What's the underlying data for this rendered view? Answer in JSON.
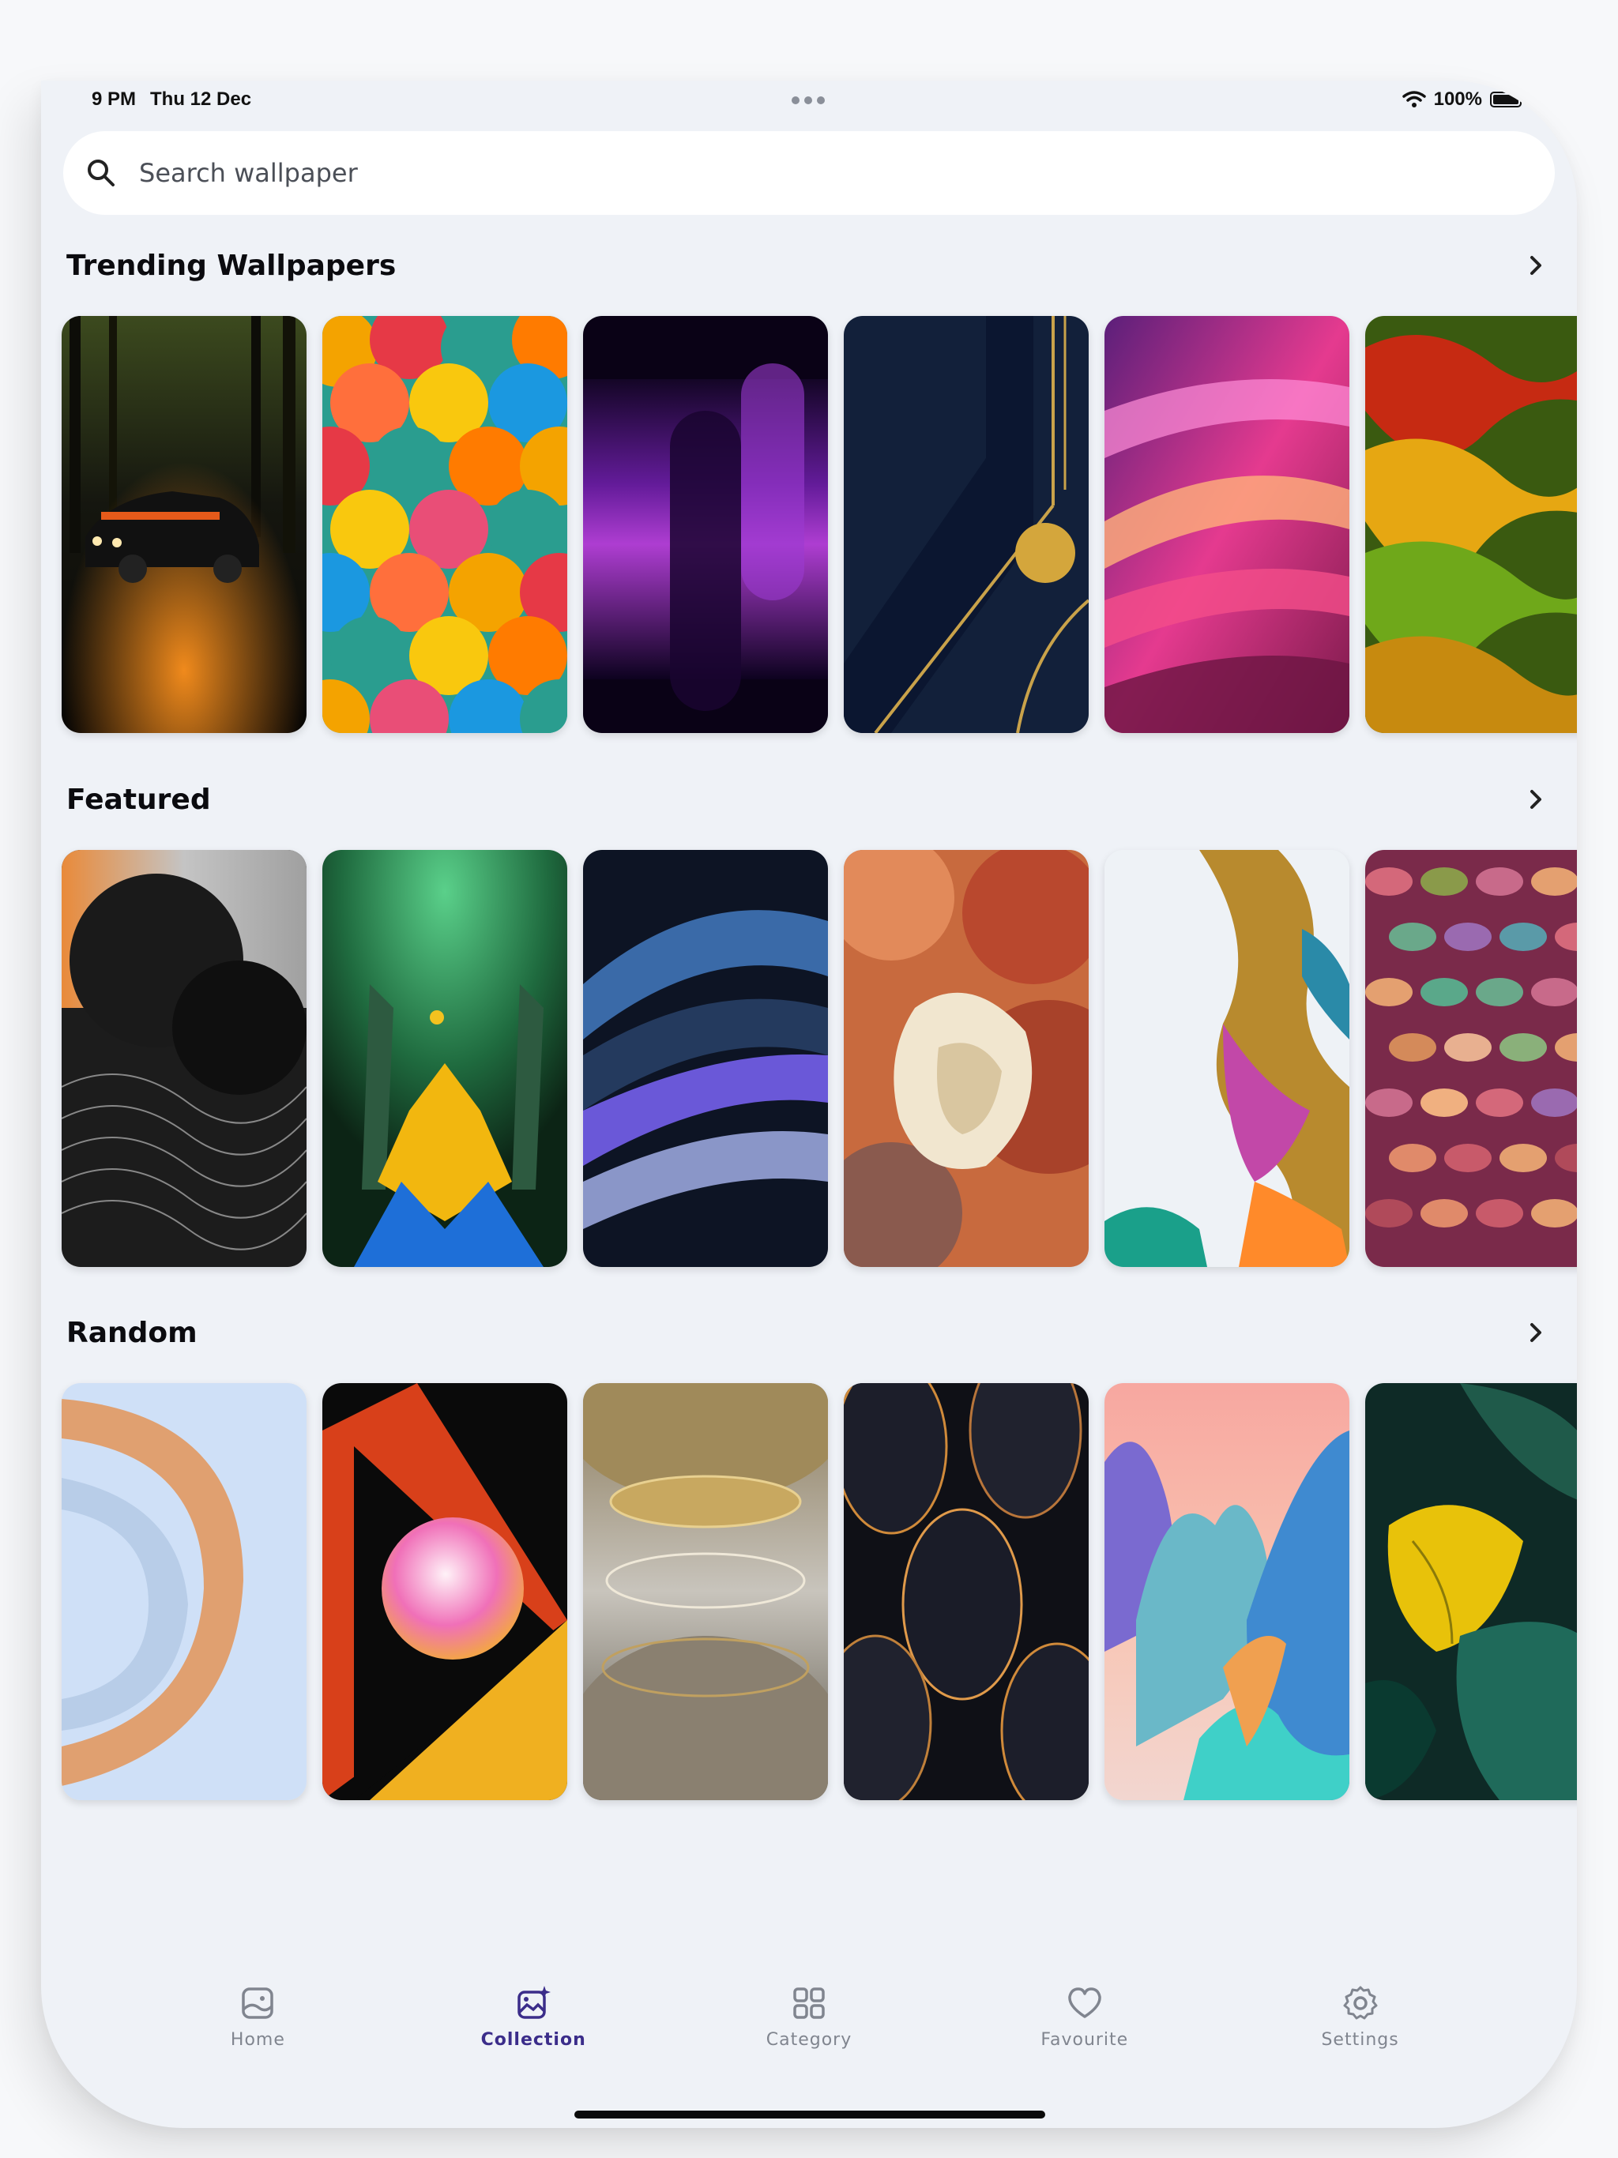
{
  "status_bar": {
    "time": "9 PM",
    "date": "Thu 12 Dec",
    "battery": "100%"
  },
  "search": {
    "placeholder": "Search wallpaper"
  },
  "sections": [
    {
      "title": "Trending Wallpapers"
    },
    {
      "title": "Featured"
    },
    {
      "title": "Random"
    }
  ],
  "nav": {
    "items": [
      {
        "label": "Home",
        "icon": "image-icon"
      },
      {
        "label": "Collection",
        "icon": "image-sparkle-icon",
        "active": true
      },
      {
        "label": "Category",
        "icon": "grid-icon"
      },
      {
        "label": "Favourite",
        "icon": "heart-icon"
      },
      {
        "label": "Settings",
        "icon": "gear-icon"
      }
    ]
  },
  "colors": {
    "accent": "#3b2d8a",
    "background": "#eff2f7",
    "inactive": "#80858f"
  }
}
